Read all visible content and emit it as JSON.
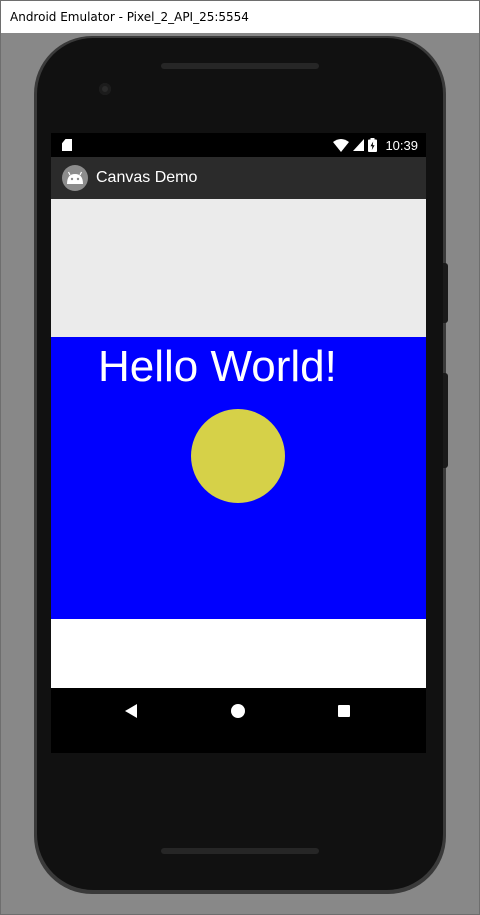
{
  "window": {
    "title": "Android Emulator - Pixel_2_API_25:5554"
  },
  "status_bar": {
    "time": "10:39",
    "icons": [
      "sd-card-icon",
      "wifi-icon",
      "cell-signal-icon",
      "battery-charging-icon"
    ]
  },
  "app_bar": {
    "icon": "android-icon",
    "title": "Canvas Demo"
  },
  "canvas": {
    "background_color": "#ebebeb",
    "rect_color": "#0000ff",
    "text": "Hello World!",
    "text_color": "#ffffff",
    "circle_color": "#d6d148"
  },
  "nav_bar": {
    "icons": [
      "back-icon",
      "home-icon",
      "recent-apps-icon"
    ]
  }
}
